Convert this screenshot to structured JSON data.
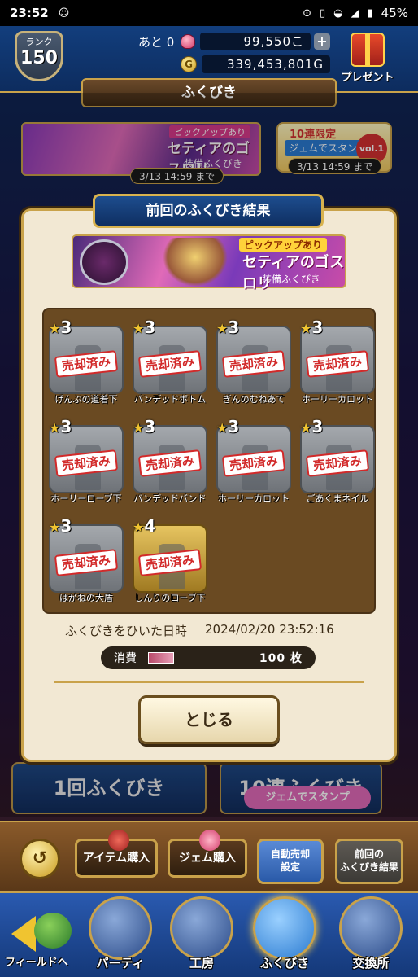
{
  "status": {
    "time": "23:52",
    "battery": "45%"
  },
  "header": {
    "rank_label": "ランク",
    "rank_value": "150",
    "ato_label": "あと 0",
    "gems": "99,550こ",
    "gold": "339,453,801G",
    "gold_symbol": "G",
    "present_label": "プレゼント"
  },
  "section_title": "ふくびき",
  "banners": {
    "main": {
      "tag": "ピックアップあり",
      "name": "セティアのゴスロリ",
      "sub": "装備ふくびき",
      "date": "3/13 14:59 まで"
    },
    "side": {
      "line1": "10連限定",
      "line2": "ジェムでスタンプ",
      "vol": "vol.1",
      "date": "3/13 14:59 まで"
    }
  },
  "dialog": {
    "title": "前回のふくびき結果",
    "banner": {
      "tag": "ピックアップあり",
      "name": "セティアのゴスロリ",
      "sub": "装備ふくびき"
    },
    "sold_label": "売却済み",
    "items": [
      {
        "stars": "3",
        "name": "げんぶの道着下",
        "tier": "silver"
      },
      {
        "stars": "3",
        "name": "バンデッドボトム",
        "tier": "silver"
      },
      {
        "stars": "3",
        "name": "ぎんのむねあて",
        "tier": "silver"
      },
      {
        "stars": "3",
        "name": "ホーリーカロット",
        "tier": "silver"
      },
      {
        "stars": "3",
        "name": "ホーリーローブ下",
        "tier": "silver"
      },
      {
        "stars": "3",
        "name": "バンデッドバンド",
        "tier": "silver"
      },
      {
        "stars": "3",
        "name": "ホーリーカロット",
        "tier": "silver"
      },
      {
        "stars": "3",
        "name": "ごあくまネイル",
        "tier": "silver"
      },
      {
        "stars": "3",
        "name": "はがねの大盾",
        "tier": "silver"
      },
      {
        "stars": "4",
        "name": "しんりのローブ下",
        "tier": "gold"
      }
    ],
    "date_label": "ふくびきをひいた日時",
    "date_value": "2024/02/20 23:52:16",
    "cost_label": "消費",
    "cost_value": "100 枚",
    "close_label": "とじる"
  },
  "background": {
    "left_banner": "1回ふくびき",
    "right_banner": "10連ふくびき",
    "stamp": "ジェムでスタンプ"
  },
  "buttons": {
    "item_buy": "アイテム購入",
    "gem_buy": "ジェム購入",
    "auto_sell_1": "自動売却",
    "auto_sell_2": "設定",
    "prev_result_1": "前回の",
    "prev_result_2": "ふくびき結果"
  },
  "nav": {
    "field": "フィールドへ",
    "party": "パーティ",
    "workshop": "工房",
    "fukubiki": "ふくびき",
    "exchange": "交換所"
  },
  "colors": {
    "accent_gold": "#c9a24a",
    "header_blue": "#123e7d",
    "sold_red": "#d22a2a",
    "dialog_bg": "#f2e8d3"
  }
}
